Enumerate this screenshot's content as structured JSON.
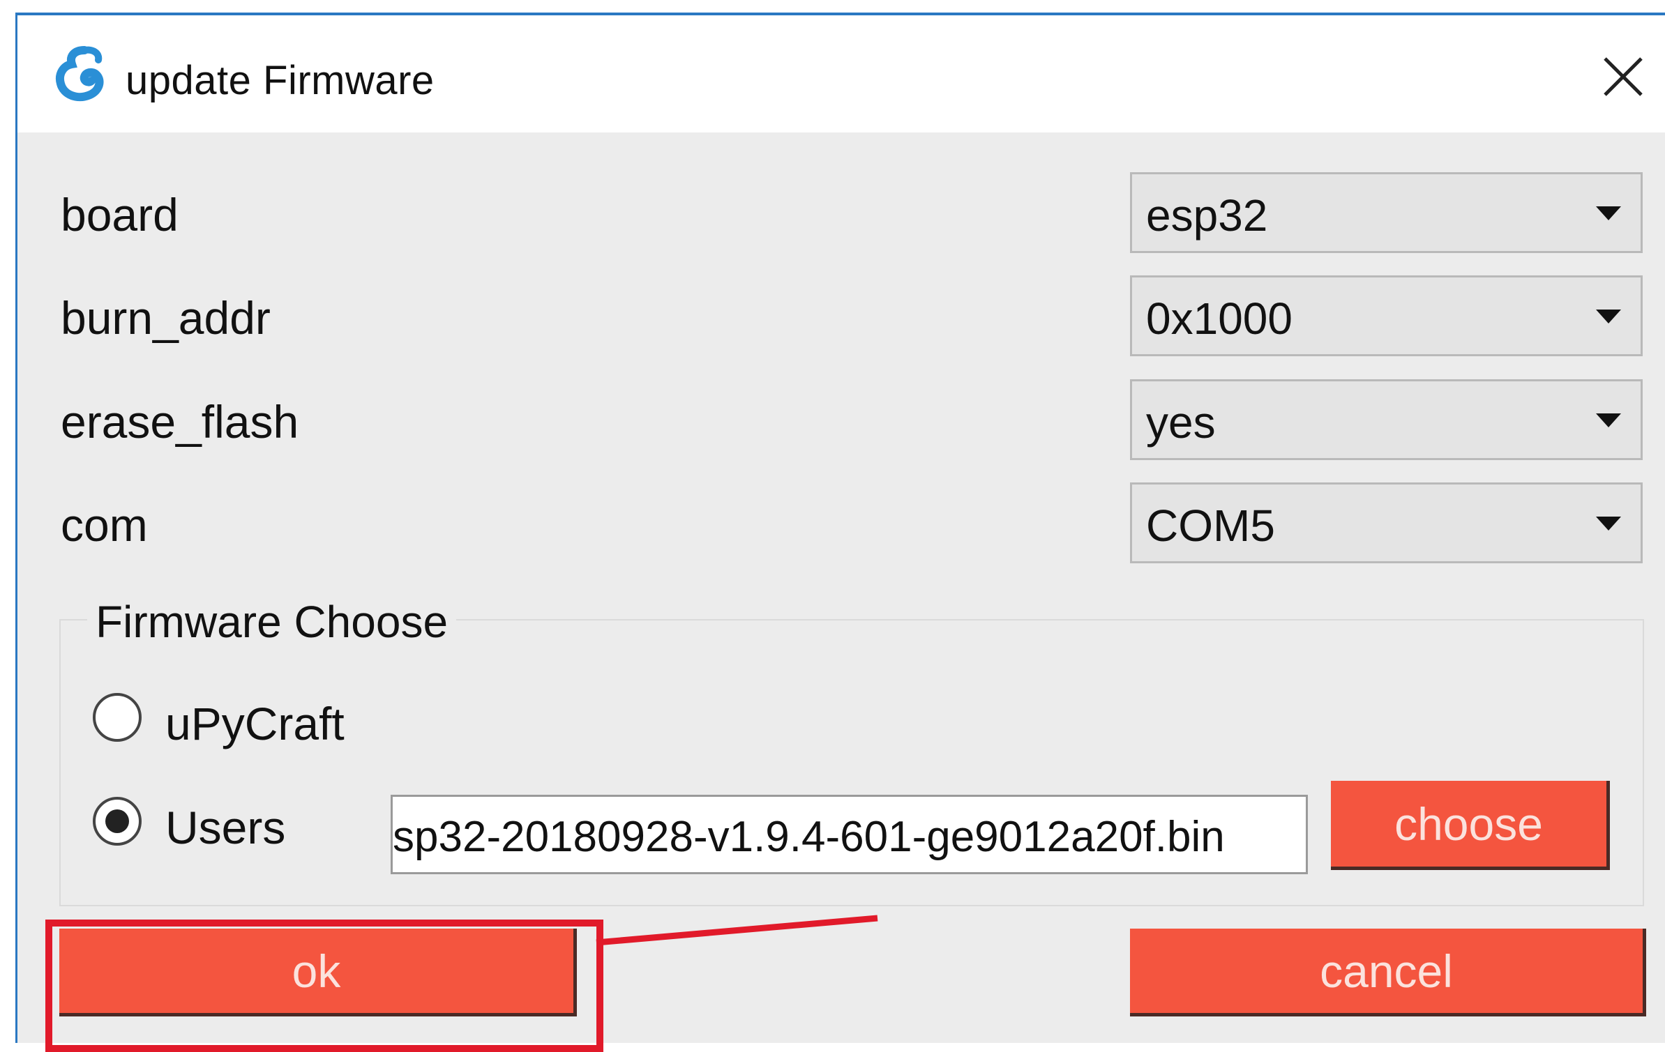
{
  "window": {
    "title": "update Firmware",
    "accent_color": "#2a78c2"
  },
  "titlebar": {
    "app_icon": "upycraft-logo-icon",
    "close_icon": "close-icon"
  },
  "fields": [
    {
      "label": "board",
      "value": "esp32"
    },
    {
      "label": "burn_addr",
      "value": "0x1000"
    },
    {
      "label": "erase_flash",
      "value": "yes"
    },
    {
      "label": "com",
      "value": "COM5"
    }
  ],
  "firmware_group": {
    "title": "Firmware Choose",
    "options": [
      {
        "label": "uPyCraft",
        "selected": false
      },
      {
        "label": "Users",
        "selected": true
      }
    ],
    "path_value": "sp32-20180928-v1.9.4-601-ge9012a20f.bin",
    "choose_label": "choose"
  },
  "buttons": {
    "ok_label": "ok",
    "cancel_label": "cancel",
    "button_color": "#f4553f"
  },
  "annotation": {
    "highlight_color": "#e11a2a"
  }
}
